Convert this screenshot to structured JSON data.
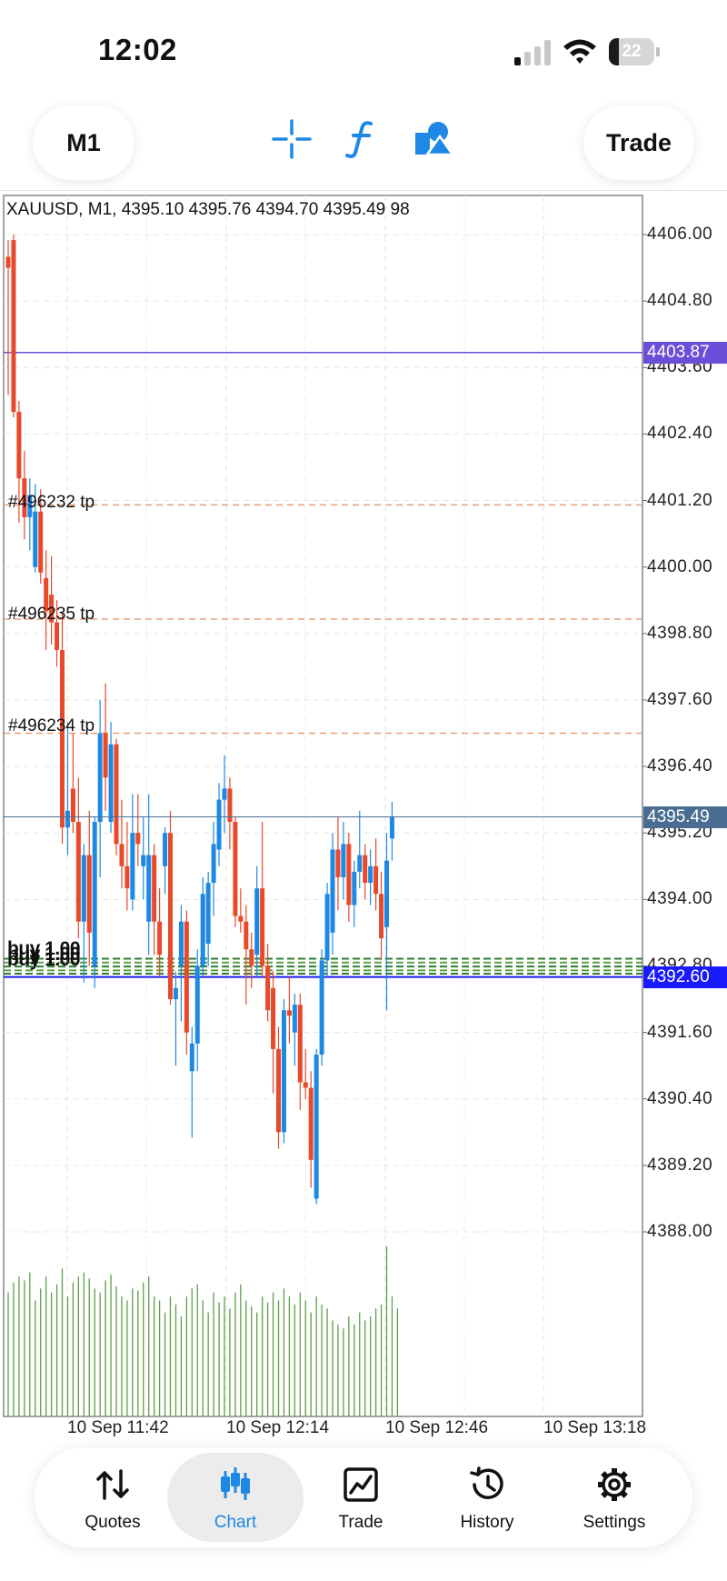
{
  "status_bar": {
    "time": "12:02",
    "battery_level": "22"
  },
  "toolbar": {
    "timeframe": "M1",
    "trade_label": "Trade",
    "icons": [
      "crosshair-icon",
      "function-icon",
      "shapes-icon"
    ]
  },
  "chart": {
    "header": "XAUUSD, M1, 4395.10 4395.76 4394.70 4395.49 98",
    "price_ticks": [
      "4406.00",
      "4404.80",
      "4403.60",
      "4402.40",
      "4401.20",
      "4400.00",
      "4398.80",
      "4397.60",
      "4396.40",
      "4395.20",
      "4394.00",
      "4392.80",
      "4391.60",
      "4390.40",
      "4389.20",
      "4388.00"
    ],
    "badges": {
      "alert_line": "4403.87",
      "current_price": "4395.49",
      "position_line": "4392.60"
    },
    "time_ticks": [
      "10 Sep 11:42",
      "10 Sep 12:14",
      "10 Sep 12:46",
      "10 Sep 13:18"
    ],
    "order_labels": [
      "#496232 tp",
      "#496235 tp",
      "#496234 tp"
    ],
    "buy_labels": [
      "buy 1.00",
      "buy 1.00",
      "buy 1.00"
    ],
    "colors": {
      "bull": "#1e88e5",
      "bear": "#e8492a",
      "volume": "#5aa045",
      "tp_line": "#e4a07a",
      "alert_line": "#6b4fd8",
      "position_line": "#1a1aff",
      "current_price": "#4a6e93"
    }
  },
  "chart_data": {
    "type": "candlestick",
    "symbol": "XAUUSD",
    "timeframe": "M1",
    "ylim": [
      4386.6,
      4407.4
    ],
    "grid": true,
    "alert_level": 4403.87,
    "current_price": 4395.49,
    "position_level": 4392.6,
    "tp_levels": [
      4401.12,
      4399.06,
      4397.0
    ],
    "candles": [
      [
        4405.6,
        4405.9,
        4403.1,
        4405.4
      ],
      [
        4405.9,
        4406.0,
        4402.7,
        4402.8
      ],
      [
        4402.8,
        4403.0,
        4400.8,
        4401.6
      ],
      [
        4401.6,
        4402.1,
        4400.5,
        4400.9
      ],
      [
        4400.9,
        4401.6,
        4400.3,
        4401.3
      ],
      [
        4400.0,
        4401.5,
        4399.9,
        4401.0
      ],
      [
        4401.0,
        4401.4,
        4399.7,
        4399.9
      ],
      [
        4399.8,
        4400.3,
        4398.5,
        4399.2
      ],
      [
        4399.5,
        4400.2,
        4398.6,
        4399.0
      ],
      [
        4399.0,
        4399.4,
        4398.2,
        4398.5
      ],
      [
        4398.5,
        4399.2,
        4395.0,
        4395.3
      ],
      [
        4395.3,
        4397.2,
        4394.8,
        4395.6
      ],
      [
        4396.0,
        4397.0,
        4395.2,
        4395.4
      ],
      [
        4395.4,
        4396.2,
        4393.3,
        4393.6
      ],
      [
        4393.6,
        4395.0,
        4392.5,
        4394.8
      ],
      [
        4394.8,
        4395.6,
        4392.8,
        4393.4
      ],
      [
        4392.8,
        4395.5,
        4392.4,
        4395.4
      ],
      [
        4395.4,
        4397.6,
        4394.4,
        4397.0
      ],
      [
        4397.0,
        4397.9,
        4395.6,
        4396.2
      ],
      [
        4395.4,
        4397.2,
        4395.2,
        4396.8
      ],
      [
        4396.8,
        4396.9,
        4394.8,
        4395.0
      ],
      [
        4395.0,
        4395.8,
        4394.2,
        4394.6
      ],
      [
        4394.6,
        4395.4,
        4393.8,
        4394.2
      ],
      [
        4394.0,
        4395.9,
        4393.8,
        4395.2
      ],
      [
        4395.2,
        4395.9,
        4394.6,
        4395.0
      ],
      [
        4394.6,
        4395.5,
        4394.0,
        4394.8
      ],
      [
        4393.6,
        4395.9,
        4393.0,
        4394.8
      ],
      [
        4394.8,
        4395.0,
        4393.0,
        4393.6
      ],
      [
        4393.6,
        4394.2,
        4392.6,
        4393.0
      ],
      [
        4394.6,
        4395.3,
        4394.1,
        4395.2
      ],
      [
        4395.2,
        4395.6,
        4392.1,
        4392.2
      ],
      [
        4392.2,
        4392.7,
        4391.0,
        4392.4
      ],
      [
        4392.8,
        4393.9,
        4391.8,
        4393.6
      ],
      [
        4393.6,
        4393.8,
        4391.2,
        4391.6
      ],
      [
        4390.9,
        4391.7,
        4389.7,
        4391.4
      ],
      [
        4391.4,
        4393.1,
        4390.9,
        4392.8
      ],
      [
        4392.8,
        4394.4,
        4392.6,
        4394.1
      ],
      [
        4393.2,
        4394.5,
        4392.8,
        4394.3
      ],
      [
        4394.3,
        4395.4,
        4393.7,
        4395.0
      ],
      [
        4394.9,
        4396.1,
        4394.6,
        4395.8
      ],
      [
        4395.8,
        4396.6,
        4395.2,
        4396.0
      ],
      [
        4396.0,
        4396.2,
        4394.9,
        4395.4
      ],
      [
        4395.4,
        4395.5,
        4393.5,
        4393.7
      ],
      [
        4393.7,
        4394.2,
        4393.4,
        4393.6
      ],
      [
        4393.6,
        4393.9,
        4392.1,
        4393.1
      ],
      [
        4393.1,
        4393.4,
        4392.4,
        4392.8
      ],
      [
        4393.0,
        4394.6,
        4392.6,
        4394.2
      ],
      [
        4394.2,
        4395.4,
        4392.6,
        4392.8
      ],
      [
        4392.8,
        4393.2,
        4391.8,
        4392.0
      ],
      [
        4392.4,
        4392.7,
        4390.5,
        4391.3
      ],
      [
        4391.3,
        4391.7,
        4389.5,
        4389.8
      ],
      [
        4389.8,
        4392.2,
        4389.6,
        4392.0
      ],
      [
        4392.0,
        4392.6,
        4391.4,
        4391.9
      ],
      [
        4391.6,
        4392.3,
        4391.0,
        4392.1
      ],
      [
        4392.1,
        4392.3,
        4390.2,
        4390.7
      ],
      [
        4390.7,
        4391.3,
        4390.4,
        4390.6
      ],
      [
        4390.6,
        4390.9,
        4388.8,
        4389.3
      ],
      [
        4388.6,
        4391.3,
        4388.5,
        4391.2
      ],
      [
        4391.2,
        4393.1,
        4391.0,
        4392.9
      ],
      [
        4392.9,
        4394.3,
        4392.6,
        4394.1
      ],
      [
        4393.4,
        4395.2,
        4393.0,
        4394.9
      ],
      [
        4394.9,
        4395.5,
        4393.8,
        4394.4
      ],
      [
        4394.4,
        4395.4,
        4394.0,
        4395.0
      ],
      [
        4395.0,
        4395.2,
        4393.6,
        4393.9
      ],
      [
        4393.9,
        4394.7,
        4393.5,
        4394.5
      ],
      [
        4394.5,
        4395.6,
        4394.2,
        4394.8
      ],
      [
        4394.8,
        4395.0,
        4394.0,
        4394.3
      ],
      [
        4394.3,
        4394.9,
        4393.9,
        4394.6
      ],
      [
        4394.6,
        4395.1,
        4393.8,
        4394.1
      ],
      [
        4394.1,
        4394.5,
        4392.9,
        4393.3
      ],
      [
        4393.5,
        4395.2,
        4392.0,
        4394.7
      ],
      [
        4395.1,
        4395.76,
        4394.7,
        4395.49
      ]
    ],
    "volumes": [
      62,
      67,
      70,
      68,
      72,
      58,
      64,
      70,
      62,
      66,
      74,
      60,
      67,
      70,
      72,
      69,
      64,
      62,
      68,
      71,
      65,
      60,
      58,
      64,
      63,
      67,
      70,
      60,
      58,
      52,
      60,
      56,
      50,
      60,
      64,
      66,
      58,
      52,
      62,
      57,
      60,
      54,
      62,
      66,
      58,
      55,
      52,
      60,
      57,
      62,
      58,
      64,
      60,
      56,
      62,
      58,
      52,
      60,
      56,
      54,
      48,
      46,
      44,
      50,
      46,
      52,
      48,
      50,
      54,
      56,
      85,
      60,
      54
    ]
  },
  "nav": {
    "items": [
      {
        "label": "Quotes",
        "icon": "quotes-icon"
      },
      {
        "label": "Chart",
        "icon": "chart-icon"
      },
      {
        "label": "Trade",
        "icon": "trade-icon"
      },
      {
        "label": "History",
        "icon": "history-icon"
      },
      {
        "label": "Settings",
        "icon": "settings-icon"
      }
    ],
    "active": "Chart"
  }
}
